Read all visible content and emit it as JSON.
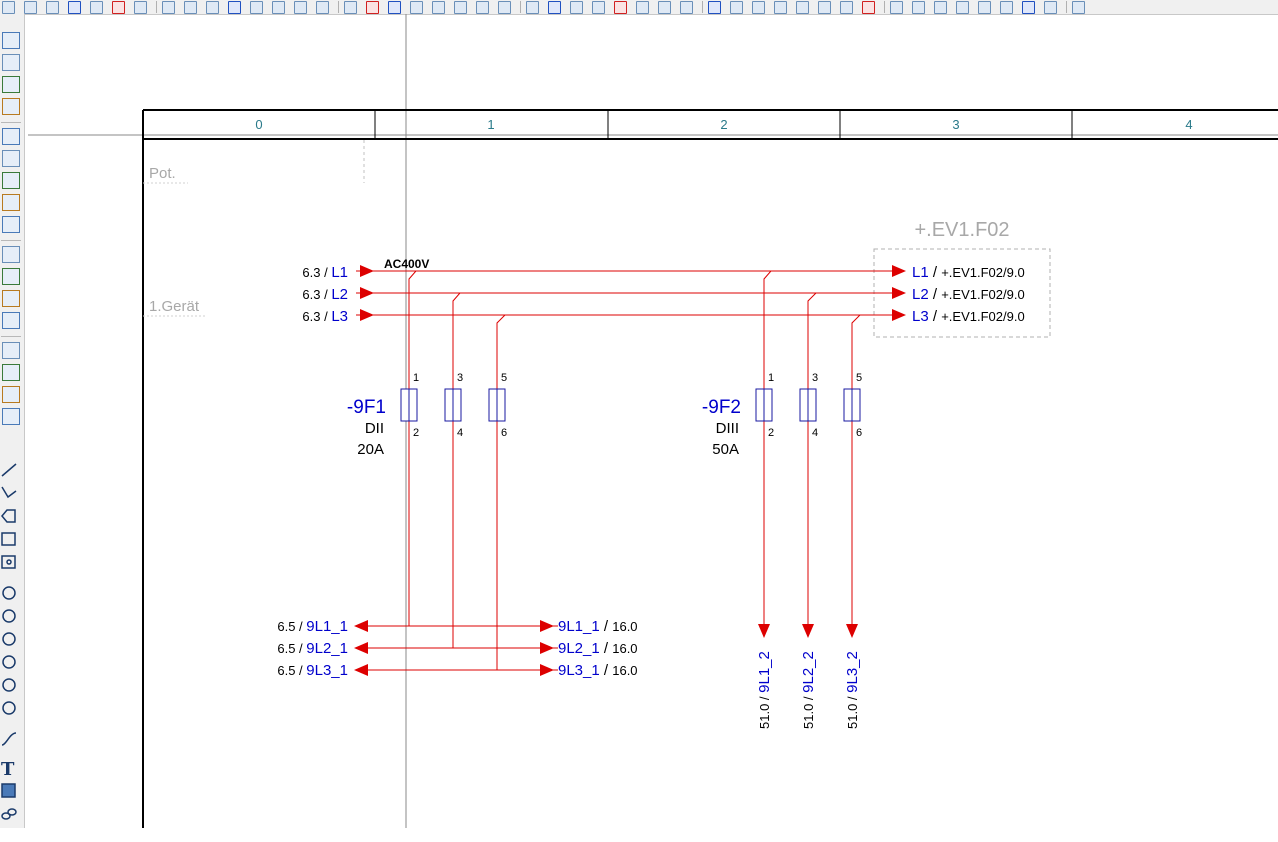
{
  "toolbar": {
    "icons": [
      "tool-icon",
      "tool-icon",
      "tool-icon",
      "tool-icon",
      "tool-icon",
      "tool-icon",
      "tool-icon",
      "tool-icon",
      "tool-icon",
      "tool-icon",
      "tool-icon",
      "tool-icon",
      "tool-icon",
      "tool-icon",
      "tool-icon",
      "tool-icon",
      "tool-icon",
      "tool-icon",
      "tool-icon",
      "tool-icon",
      "tool-icon",
      "tool-icon",
      "tool-icon",
      "tool-icon",
      "tool-icon",
      "tool-icon",
      "tool-icon",
      "tool-icon",
      "tool-icon",
      "tool-icon",
      "tool-icon",
      "tool-icon",
      "tool-icon",
      "tool-icon",
      "tool-icon",
      "tool-icon",
      "tool-icon",
      "tool-icon",
      "tool-icon",
      "tool-icon",
      "tool-icon",
      "tool-icon",
      "tool-icon",
      "tool-icon",
      "tool-icon",
      "tool-icon",
      "tool-icon",
      "tool-icon"
    ]
  },
  "left_toolbar": {
    "groups": [
      "page-tools",
      "device-tools",
      "symbol-tools",
      "graphics-tools"
    ],
    "graphics_icons": [
      "line-icon",
      "polyline-icon",
      "polygon-icon",
      "rectangle-icon",
      "image-frame-icon",
      "circle-icon",
      "circle-arc-icon",
      "pie-icon",
      "arc-icon",
      "ellipse-circle-icon",
      "ellipse-icon",
      "spline-icon",
      "text-icon",
      "picture-icon",
      "link-icon"
    ]
  },
  "frame": {
    "columns": [
      "0",
      "1",
      "2",
      "3",
      "4"
    ],
    "row_labels": [
      "Pot.",
      "1.Gerät"
    ]
  },
  "schematic": {
    "supply_label": "AC400V",
    "colors": {
      "wire": "#dd0000",
      "text_blue": "#0000cc",
      "grid": "#404040",
      "column_text": "#2a7a8a",
      "faint": "#a8a8a8"
    },
    "incoming": [
      {
        "ref": "6.3",
        "sep": " / ",
        "name": "L1"
      },
      {
        "ref": "6.3",
        "sep": " / ",
        "name": "L2"
      },
      {
        "ref": "6.3",
        "sep": " / ",
        "name": "L3"
      }
    ],
    "cross_ref_box": {
      "title": "+.EV1.F02",
      "items": [
        {
          "name": "L1",
          "sep": " / ",
          "ref": "+.EV1.F02/9.0"
        },
        {
          "name": "L2",
          "sep": " / ",
          "ref": "+.EV1.F02/9.0"
        },
        {
          "name": "L3",
          "sep": " / ",
          "ref": "+.EV1.F02/9.0"
        }
      ]
    },
    "fuses": [
      {
        "tag": "-9F1",
        "type": "DII",
        "rating": "20A",
        "top_pins": [
          "1",
          "3",
          "5"
        ],
        "bottom_pins": [
          "2",
          "4",
          "6"
        ]
      },
      {
        "tag": "-9F2",
        "type": "DIII",
        "rating": "50A",
        "top_pins": [
          "1",
          "3",
          "5"
        ],
        "bottom_pins": [
          "2",
          "4",
          "6"
        ]
      }
    ],
    "outputs_left": [
      {
        "ref": "6.5",
        "sep": " / ",
        "name": "9L1_1"
      },
      {
        "ref": "6.5",
        "sep": " / ",
        "name": "9L2_1"
      },
      {
        "ref": "6.5",
        "sep": " / ",
        "name": "9L3_1"
      }
    ],
    "outputs_right": [
      {
        "name": "9L1_1",
        "sep": " / ",
        "ref": "16.0"
      },
      {
        "name": "9L2_1",
        "sep": " / ",
        "ref": "16.0"
      },
      {
        "name": "9L3_1",
        "sep": " / ",
        "ref": "16.0"
      }
    ],
    "outputs_vertical": [
      {
        "ref": "51.0",
        "sep": " / ",
        "name": "9L1_2"
      },
      {
        "ref": "51.0",
        "sep": " / ",
        "name": "9L2_2"
      },
      {
        "ref": "51.0",
        "sep": " / ",
        "name": "9L3_2"
      }
    ]
  }
}
